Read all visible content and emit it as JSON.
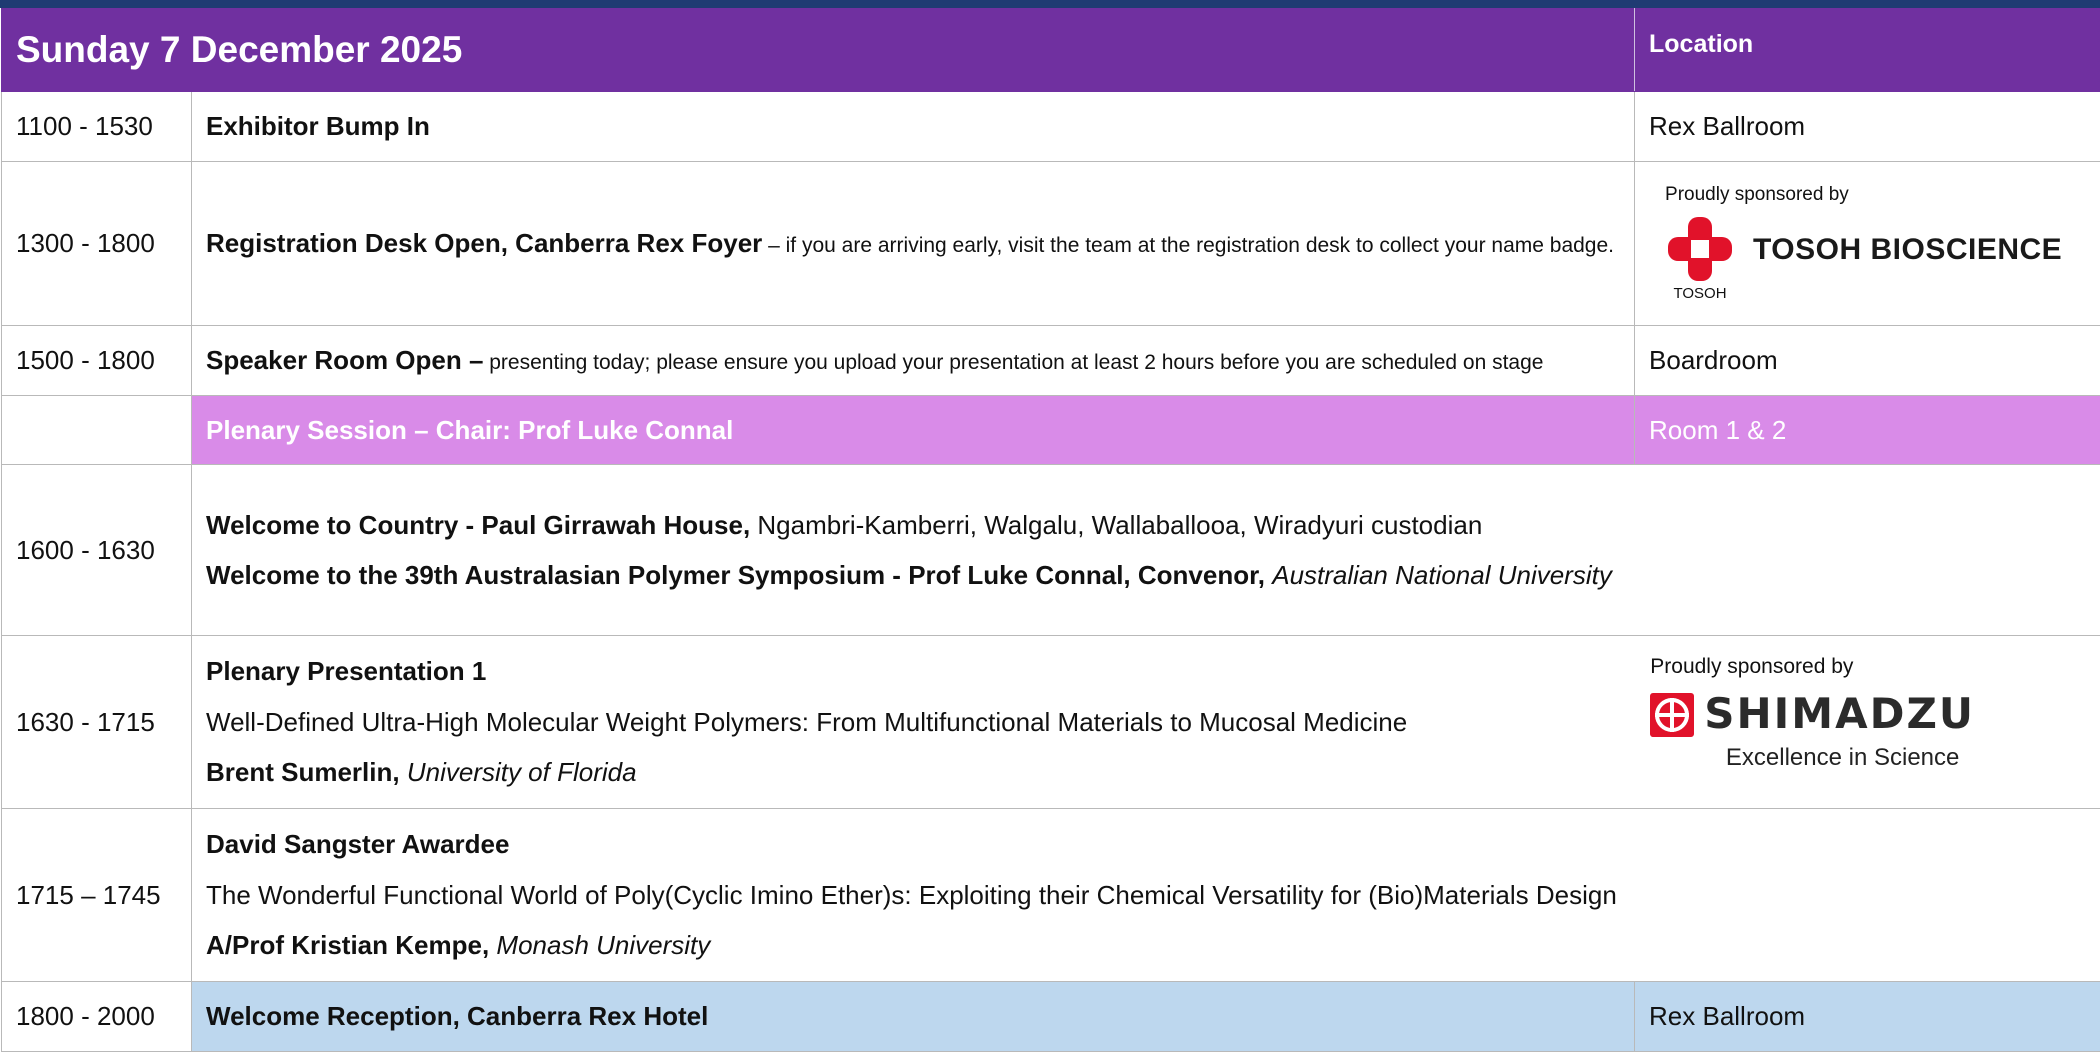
{
  "header": {
    "day": "Sunday 7 December 2025",
    "location_label": "Location"
  },
  "rows": [
    {
      "time": "1100 - 1530",
      "title": "Exhibitor Bump In",
      "location": "Rex Ballroom"
    },
    {
      "time": "1300 - 1800",
      "title": "Registration Desk Open, Canberra Rex Foyer",
      "desc": " – if you are arriving early, visit the team at the registration desk to collect your name badge.",
      "sponsor": {
        "label": "Proudly sponsored by",
        "name": "TOSOH BIOSCIENCE",
        "small": "TOSOH",
        "color": "#e1122a"
      }
    },
    {
      "time": "1500 - 1800",
      "title": "Speaker Room Open –",
      "desc": " presenting today; please ensure you upload your presentation at least 2 hours before you are scheduled on stage",
      "location": "Boardroom"
    },
    {
      "time": "",
      "title": "Plenary Session – Chair: Prof Luke Connal",
      "location": "Room 1 & 2",
      "color": "#d98be8"
    },
    {
      "time": "1600 - 1630",
      "line1_bold": "Welcome to Country - Paul Girrawah House,",
      "line1_rest": " Ngambri-Kamberri, Walgalu, Wallaballooa, Wiradyuri custodian",
      "line2_bold": "Welcome to the 39th Australasian Polymer Symposium - Prof Luke Connal, Convenor,",
      "line2_italic": "Australian National University"
    },
    {
      "time": "1630 - 1715",
      "heading": "Plenary Presentation 1",
      "talk": "Well-Defined Ultra-High Molecular Weight Polymers: From Multifunctional Materials to Mucosal Medicine",
      "speaker": "Brent Sumerlin,",
      "affiliation": "University of Florida",
      "sponsor": {
        "label": "Proudly sponsored by",
        "name": "SHIMADZU",
        "tagline": "Excellence in Science",
        "color": "#e1122a"
      }
    },
    {
      "time": "1715 – 1745",
      "heading": "David Sangster Awardee",
      "talk": "The Wonderful Functional World of Poly(Cyclic Imino Ether)s: Exploiting their Chemical Versatility for (Bio)Materials Design",
      "speaker": "A/Prof Kristian Kempe,",
      "affiliation": "Monash University"
    },
    {
      "time": "1800 - 2000",
      "title": "Welcome Reception, Canberra Rex Hotel",
      "location": "Rex Ballroom",
      "color": "#bdd7ee"
    }
  ],
  "colors": {
    "header": "#7030a0",
    "topbar": "#1f3b73"
  }
}
